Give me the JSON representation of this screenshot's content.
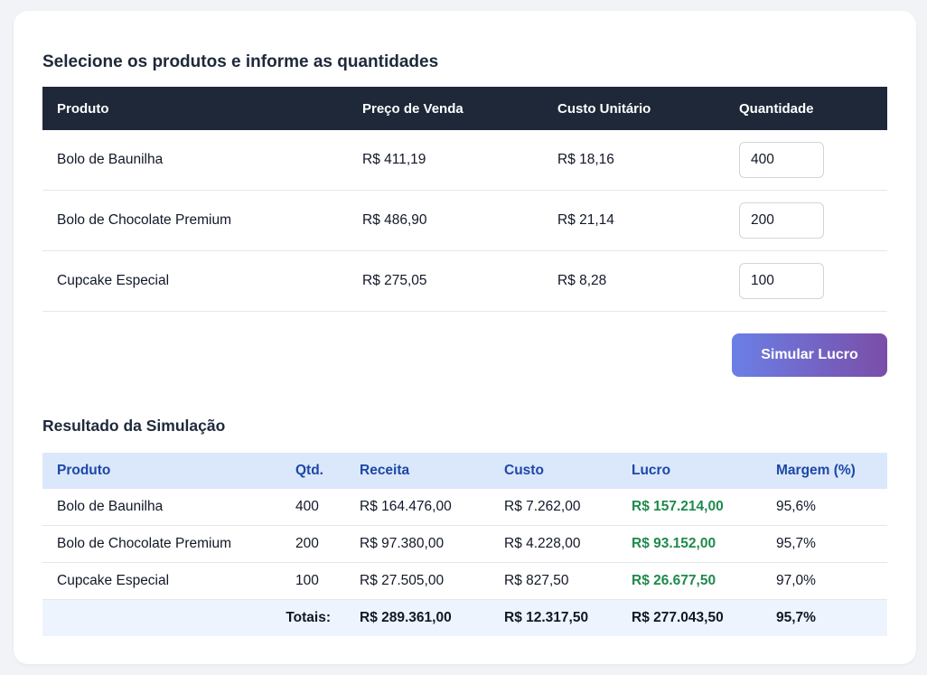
{
  "selection": {
    "title": "Selecione os produtos e informe as quantidades",
    "headers": [
      "Produto",
      "Preço de Venda",
      "Custo Unitário",
      "Quantidade"
    ],
    "rows": [
      {
        "product": "Bolo de Baunilha",
        "price": "R$ 411,19",
        "cost": "R$ 18,16",
        "quantity": "400"
      },
      {
        "product": "Bolo de Chocolate Premium",
        "price": "R$ 486,90",
        "cost": "R$ 21,14",
        "quantity": "200"
      },
      {
        "product": "Cupcake Especial",
        "price": "R$ 275,05",
        "cost": "R$ 8,28",
        "quantity": "100"
      }
    ],
    "button_label": "Simular Lucro"
  },
  "result": {
    "title": "Resultado da Simulação",
    "headers": [
      "Produto",
      "Qtd.",
      "Receita",
      "Custo",
      "Lucro",
      "Margem (%)"
    ],
    "rows": [
      {
        "product": "Bolo de Baunilha",
        "qty": "400",
        "revenue": "R$ 164.476,00",
        "cost": "R$ 7.262,00",
        "profit": "R$ 157.214,00",
        "margin": "95,6%"
      },
      {
        "product": "Bolo de Chocolate Premium",
        "qty": "200",
        "revenue": "R$ 97.380,00",
        "cost": "R$ 4.228,00",
        "profit": "R$ 93.152,00",
        "margin": "95,7%"
      },
      {
        "product": "Cupcake Especial",
        "qty": "100",
        "revenue": "R$ 27.505,00",
        "cost": "R$ 827,50",
        "profit": "R$ 26.677,50",
        "margin": "97,0%"
      }
    ],
    "totals": {
      "label": "Totais:",
      "revenue": "R$ 289.361,00",
      "cost": "R$ 12.317,50",
      "profit": "R$ 277.043,50",
      "margin": "95,7%"
    }
  },
  "colors": {
    "header_dark": "#1e2838",
    "result_header": "#dbe8fb",
    "profit_green": "#1f8a4c",
    "button_start": "#6b7fe6",
    "button_end": "#7a4ea8"
  }
}
